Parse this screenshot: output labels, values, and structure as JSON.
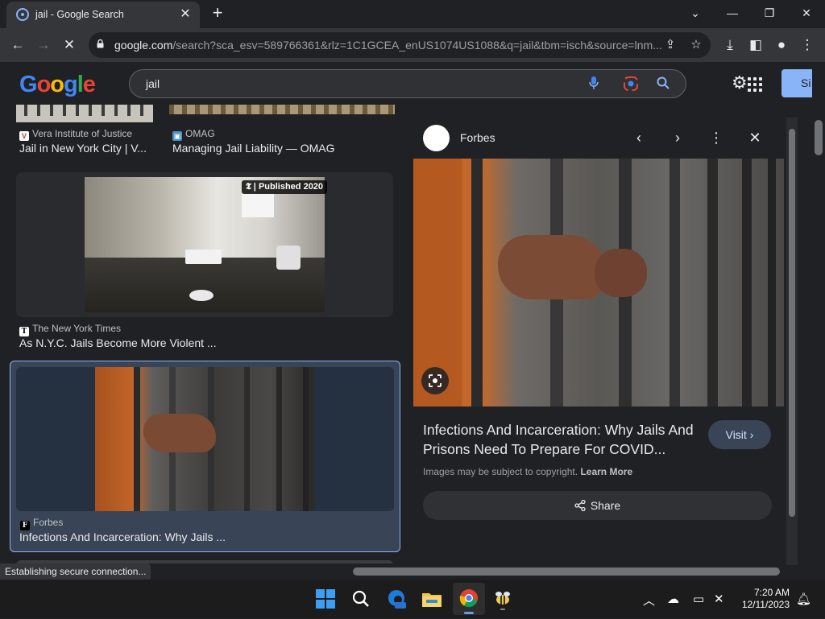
{
  "browser": {
    "tab_title": "jail - Google Search",
    "url_host": "google.com",
    "url_rest": "/search?sca_esv=589766361&rlz=1C1GCEA_enUS1074US1088&q=jail&tbm=isch&source=lnm..."
  },
  "search": {
    "logo": "Google",
    "query": "jail",
    "signin_label": "Si"
  },
  "results": [
    {
      "source": "Vera Institute of Justice",
      "title": "Jail in New York City | V..."
    },
    {
      "source": "OMAG",
      "title": "Managing Jail Liability — OMAG"
    },
    {
      "source": "The New York Times",
      "title": "As N.Y.C. Jails Become More Violent ...",
      "badge": "Published 2020"
    },
    {
      "source": "Forbes",
      "title": "Infections And Incarceration: Why Jails ..."
    }
  ],
  "panel": {
    "source": "Forbes",
    "title": "Infections And Incarceration: Why Jails And Prisons Need To Prepare For COVID...",
    "visit_label": "Visit",
    "copyright_text": "Images may be subject to copyright.",
    "learn_more": "Learn More",
    "share_label": "Share"
  },
  "status_text": "Establishing secure connection...",
  "taskbar": {
    "time": "7:20 AM",
    "date": "12/11/2023"
  }
}
